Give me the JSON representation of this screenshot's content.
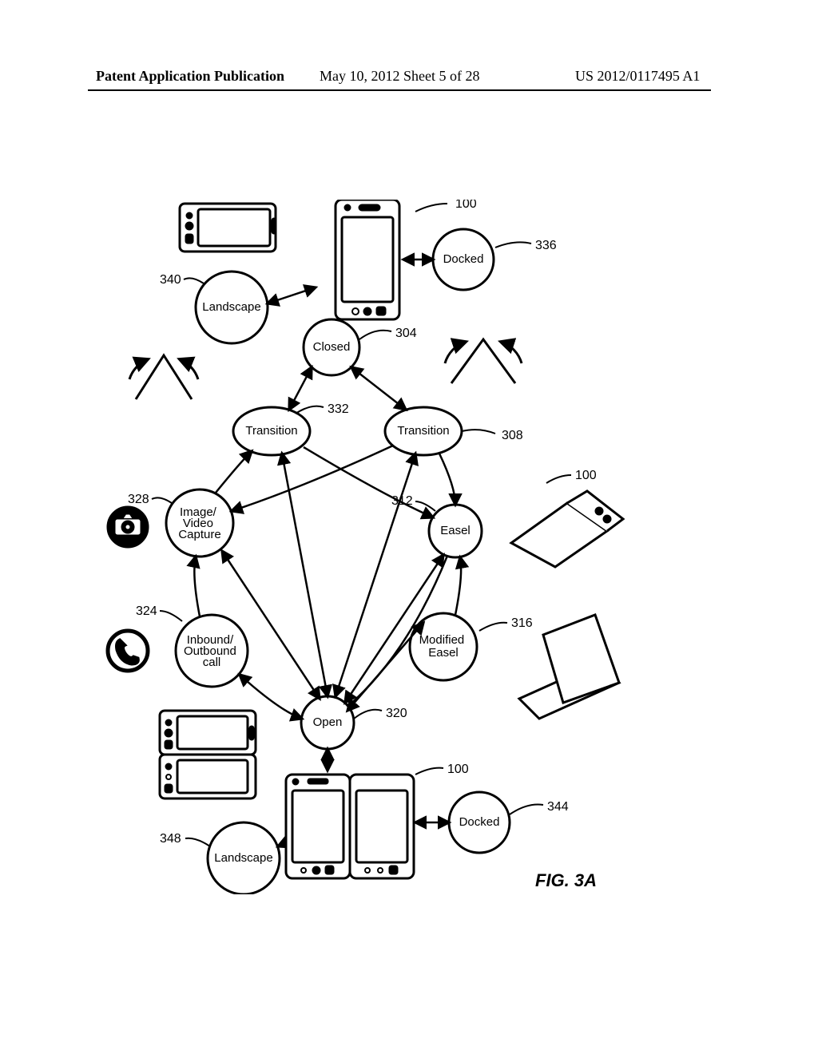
{
  "header": {
    "left": "Patent Application Publication",
    "center": "May 10, 2012  Sheet 5 of 28",
    "right": "US 2012/0117495 A1"
  },
  "figure_label": "FIG. 3A",
  "states": {
    "closed": "Closed",
    "docked1": "Docked",
    "landscape1": "Landscape",
    "trans_left": "Transition",
    "trans_right": "Transition",
    "easel": "Easel",
    "mod_easel": "Modified\nEasel",
    "img_video": "Image/\nVideo\nCapture",
    "call": "Inbound/\nOutbound\ncall",
    "open": "Open",
    "docked2": "Docked",
    "landscape2": "Landscape"
  },
  "refs": {
    "r100a": "100",
    "r336": "336",
    "r340": "340",
    "r304": "304",
    "r332": "332",
    "r308": "308",
    "r328": "328",
    "r100b": "100",
    "r312": "312",
    "r324": "324",
    "r316": "316",
    "r320": "320",
    "r100c": "100",
    "r344": "344",
    "r348": "348"
  }
}
